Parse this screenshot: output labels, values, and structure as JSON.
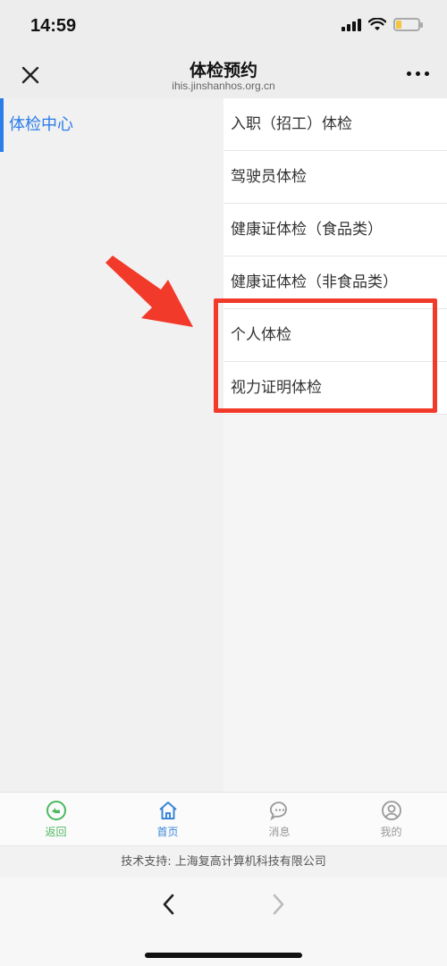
{
  "status_bar": {
    "time": "14:59"
  },
  "nav": {
    "title": "体检预约",
    "subtitle": "ihis.jinshanhos.org.cn"
  },
  "left_menu": {
    "selected": "体检中心"
  },
  "right_menu": {
    "items": [
      "入职（招工）体检",
      "驾驶员体检",
      "健康证体检（食品类）",
      "健康证体检（非食品类）",
      "个人体检",
      "视力证明体检"
    ]
  },
  "tabs": [
    {
      "label": "返回",
      "icon": "back-icon"
    },
    {
      "label": "首页",
      "icon": "home-icon"
    },
    {
      "label": "消息",
      "icon": "message-icon"
    },
    {
      "label": "我的",
      "icon": "user-icon"
    }
  ],
  "footer": {
    "text": "技术支持: 上海复高计算机科技有限公司"
  },
  "colors": {
    "accent": "#2b7de9",
    "highlight": "#f23a2b",
    "back_tab": "#4cb860"
  }
}
